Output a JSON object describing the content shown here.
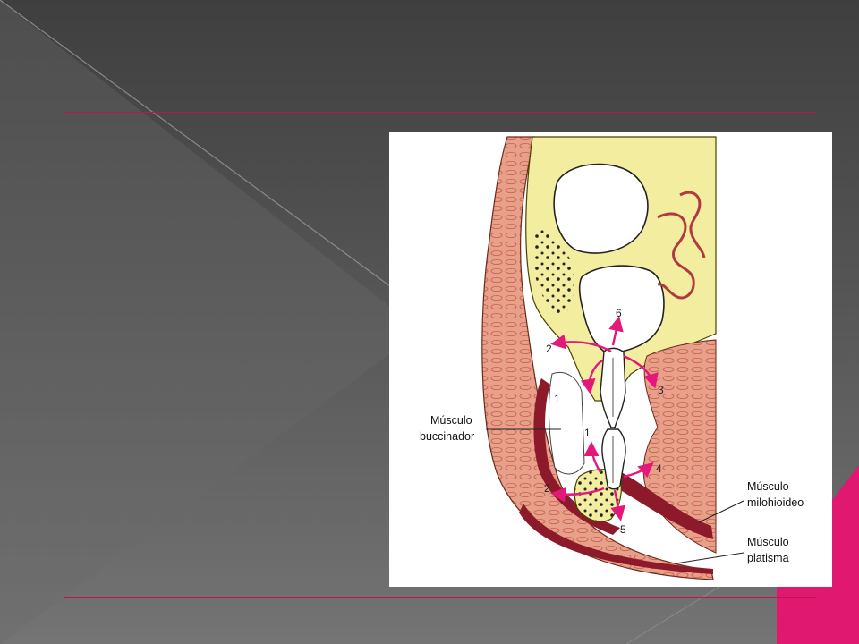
{
  "diagram": {
    "labels": {
      "buccinador": [
        "Músculo",
        "buccinador"
      ],
      "milohioideo": [
        "Músculo",
        "milohioideo"
      ],
      "platisma": [
        "Músculo",
        "platisma"
      ]
    },
    "numbers": [
      "1",
      "1",
      "2",
      "2",
      "3",
      "4",
      "5",
      "6"
    ]
  },
  "colors": {
    "accent_line": "#c0144e",
    "accent_triangle": "#e0186f",
    "arrows": "#e4187a",
    "bone": "#f3eda0",
    "muscle": "#e9a08a",
    "muscle_dark": "#8c1a2a"
  }
}
